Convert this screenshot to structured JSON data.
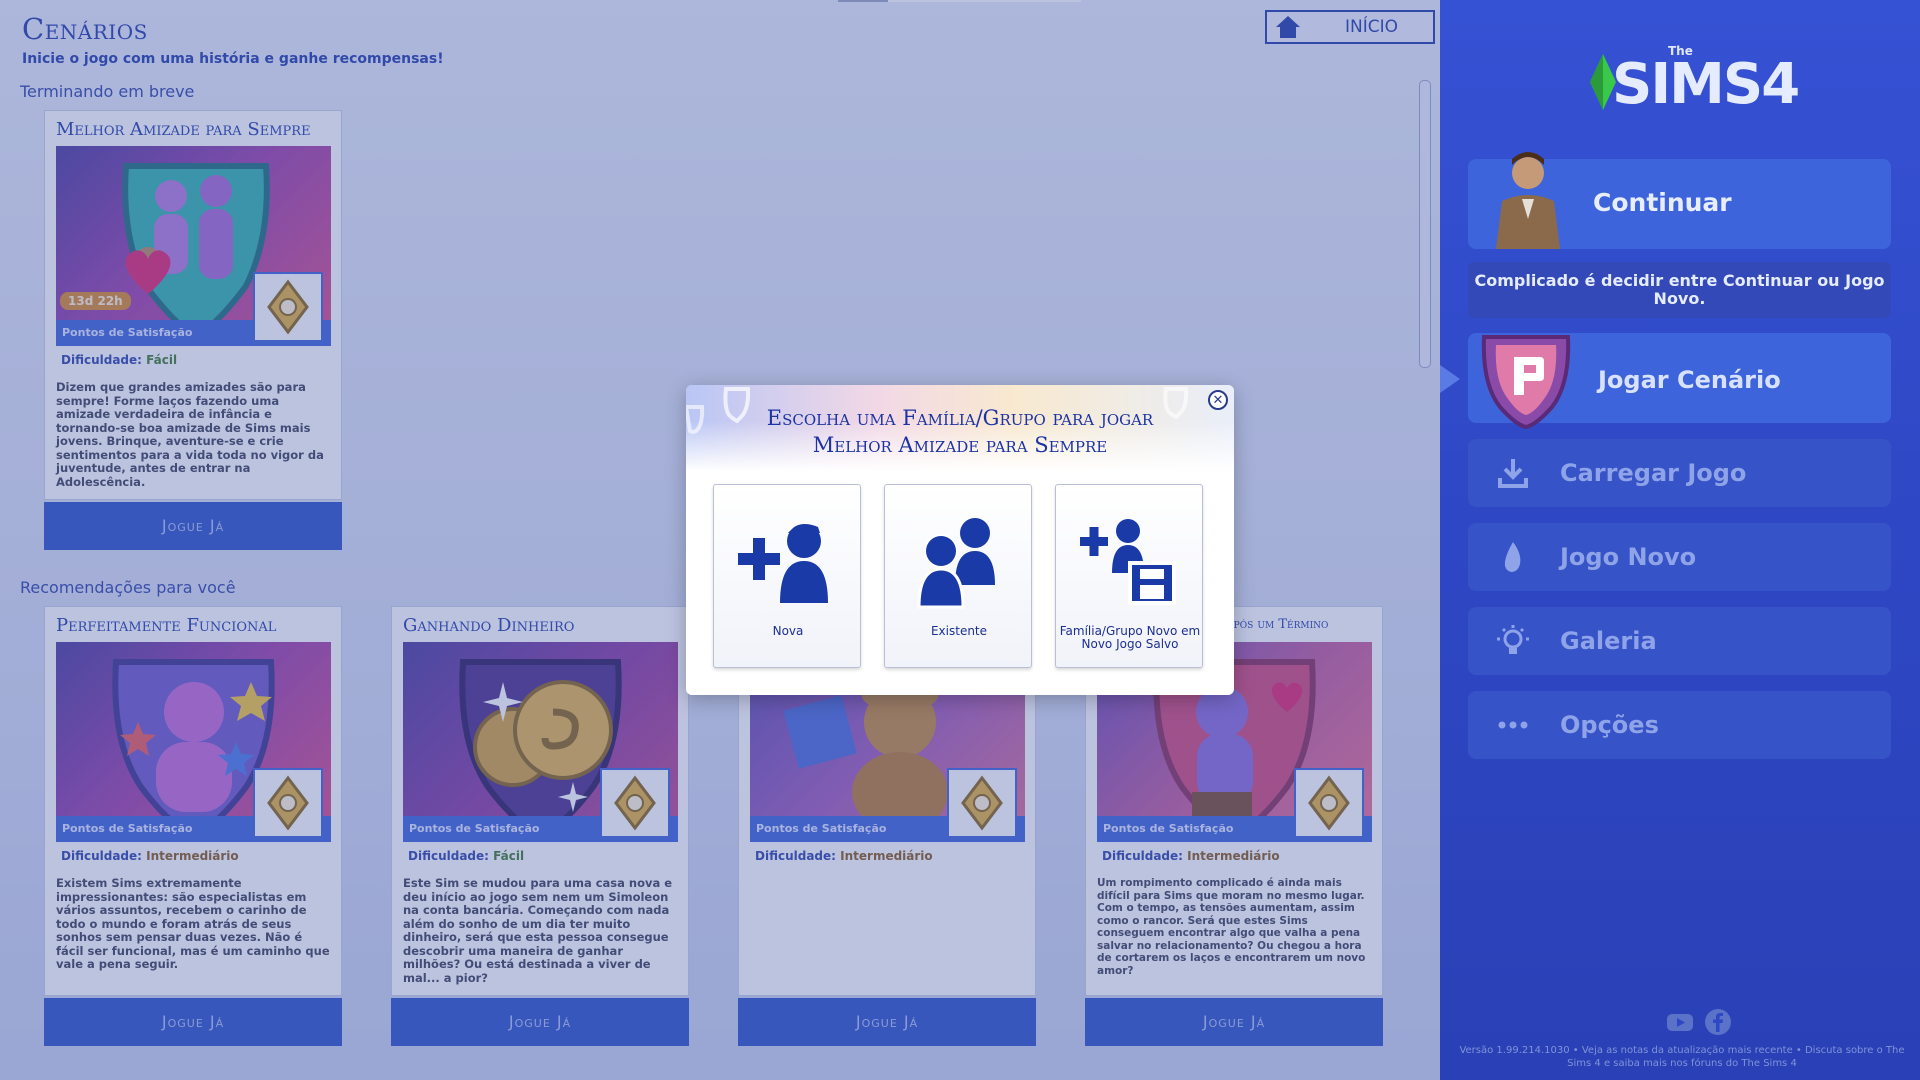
{
  "page": {
    "title": "Cenários",
    "subtitle": "Inicie o jogo com uma história e ganhe recompensas!",
    "home_button": "INÍCIO",
    "section_soon": "Terminando em breve",
    "section_recommended": "Recomendações para você"
  },
  "cards": [
    {
      "title": "Melhor Amizade para Sempre",
      "timer": "13d 22h",
      "points_label": "Pontos de Satisfação",
      "difficulty_label": "Dificuldade:",
      "difficulty_value": "Fácil",
      "description": "Dizem que grandes amizades são para sempre! Forme laços fazendo uma amizade verdadeira de infância e tornando-se boa amizade de Sims mais jovens. Brinque, aventure-se e crie sentimentos para a vida toda no vigor da juventude, antes de entrar na Adolescência.",
      "play": "Jogue Já"
    },
    {
      "title": "Perfeitamente Funcional",
      "points_label": "Pontos de Satisfação",
      "difficulty_label": "Dificuldade:",
      "difficulty_value": "Intermediário",
      "description": "Existem Sims extremamente impressionantes: são especialistas em vários assuntos, recebem o carinho de todo o mundo e foram atrás de seus sonhos sem pensar duas vezes. Não é fácil ser funcional, mas é um caminho que vale a pena seguir.",
      "play": "Jogue Já"
    },
    {
      "title": "Ganhando Dinheiro",
      "points_label": "Pontos de Satisfação",
      "difficulty_label": "Dificuldade:",
      "difficulty_value": "Fácil",
      "description": "Este Sim se mudou para uma casa nova e deu início ao jogo sem nem um Simoleon na conta bancária. Começando com nada além do sonho de um dia ter muito dinheiro, será que esta pessoa consegue descobrir uma maneira de ganhar milhões? Ou está destinada a viver de mal... a pior?",
      "play": "Jogue Já"
    },
    {
      "title": "",
      "points_label": "Pontos de Satisfação",
      "difficulty_label": "Dificuldade:",
      "difficulty_value": "Intermediário",
      "description": "",
      "play": "Jogue Já"
    },
    {
      "title": "or Após um Término",
      "points_label": "Pontos de Satisfação",
      "difficulty_label": "Dificuldade:",
      "difficulty_value": "Intermediário",
      "description": "Um rompimento complicado é ainda mais difícil para Sims que moram no mesmo lugar. Com o tempo, as tensões aumentam, assim como o rancor. Será que estes Sims conseguem encontrar algo que valha a pena salvar no relacionamento? Ou chegou a hora de cortarem os laços e encontrarem um novo amor?",
      "play": "Jogue Já"
    }
  ],
  "menu": {
    "logo_the": "The",
    "logo_text": "SIMS4",
    "continue": "Continuar",
    "hint": "Complicado é decidir entre Continuar ou Jogo Novo.",
    "play_scenario": "Jogar Cenário",
    "load_game": "Carregar Jogo",
    "new_game": "Jogo Novo",
    "gallery": "Galeria",
    "options": "Opções",
    "footer": "Versão 1.99.214.1030 • Veja as notas da atualização mais recente • Discuta sobre o The Sims 4 e saiba mais nos fóruns do The Sims 4"
  },
  "modal": {
    "title_line1": "Escolha uma Família/Grupo para jogar",
    "title_line2": "Melhor Amizade para Sempre",
    "options": [
      {
        "label": "Nova"
      },
      {
        "label": "Existente"
      },
      {
        "label": "Família/Grupo Novo em Novo Jogo Salvo"
      }
    ]
  },
  "colors": {
    "accent": "#1f3aa8",
    "menu_bg": "#3652d4",
    "play_button": "#2a52c8",
    "easy_green": "#3e7a2c"
  }
}
